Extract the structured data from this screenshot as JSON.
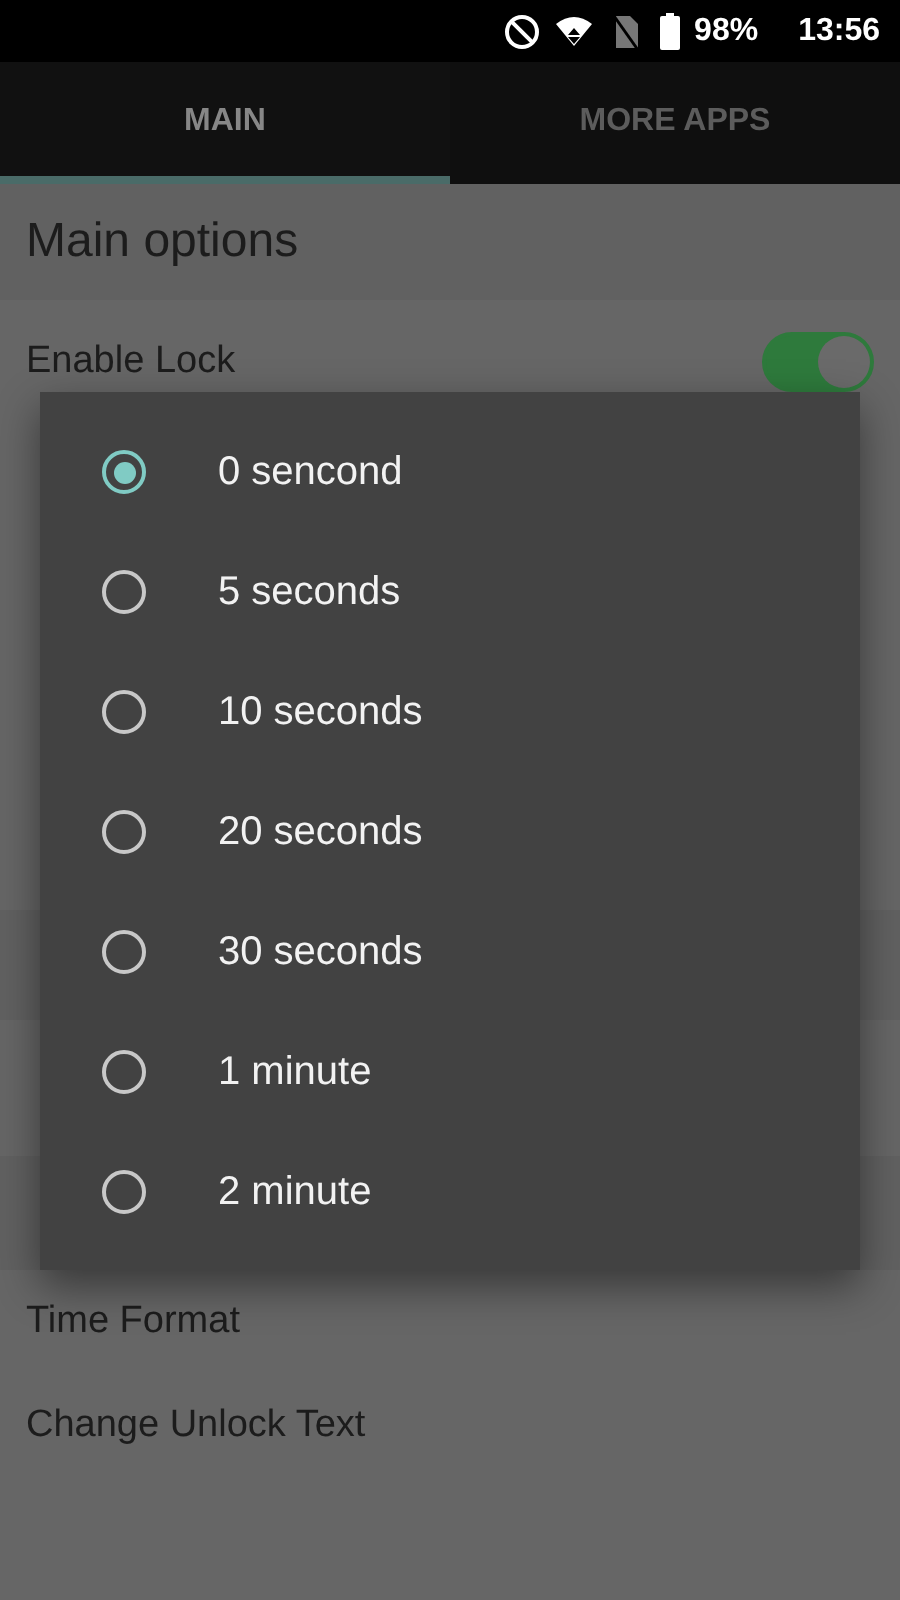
{
  "status_bar": {
    "battery": "98%",
    "time": "13:56"
  },
  "tabs": [
    {
      "label": "MAIN",
      "selected": true
    },
    {
      "label": "MORE APPS",
      "selected": false
    }
  ],
  "section": {
    "title": "Main options",
    "rows": [
      {
        "label": "Enable Lock",
        "kind": "switch",
        "on": true
      }
    ]
  },
  "lower_rows": [
    {
      "label": "Time Format"
    },
    {
      "label": "Change Unlock Text"
    }
  ],
  "dialog": {
    "options": [
      {
        "label": "0 sencond",
        "selected": true
      },
      {
        "label": "5 seconds",
        "selected": false
      },
      {
        "label": "10 seconds",
        "selected": false
      },
      {
        "label": "20 seconds",
        "selected": false
      },
      {
        "label": "30 seconds",
        "selected": false
      },
      {
        "label": "1 minute",
        "selected": false
      },
      {
        "label": "2 minute",
        "selected": false
      }
    ]
  }
}
